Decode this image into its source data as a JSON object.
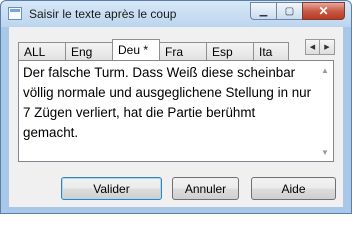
{
  "window": {
    "title": "Saisir le texte après le coup",
    "minimize_glyph": "▁",
    "maximize_glyph": "▢",
    "close_glyph": "✕"
  },
  "tabs": [
    {
      "label": "ALL"
    },
    {
      "label": "Eng"
    },
    {
      "label": "Deu *",
      "active": true
    },
    {
      "label": "Fra"
    },
    {
      "label": "Esp"
    },
    {
      "label": "Ita"
    }
  ],
  "tab_scroll": {
    "left_glyph": "◀",
    "right_glyph": "▶"
  },
  "editor": {
    "text": "Der falsche Turm. Dass Weiß diese scheinbar völlig normale und ausgeglichene Stellung in nur 7 Zügen verliert, hat die Partie berühmt gemacht.",
    "scroll_up_glyph": "▲",
    "scroll_down_glyph": "▼"
  },
  "buttons": {
    "ok": "Valider",
    "cancel": "Annuler",
    "help": "Aide"
  }
}
